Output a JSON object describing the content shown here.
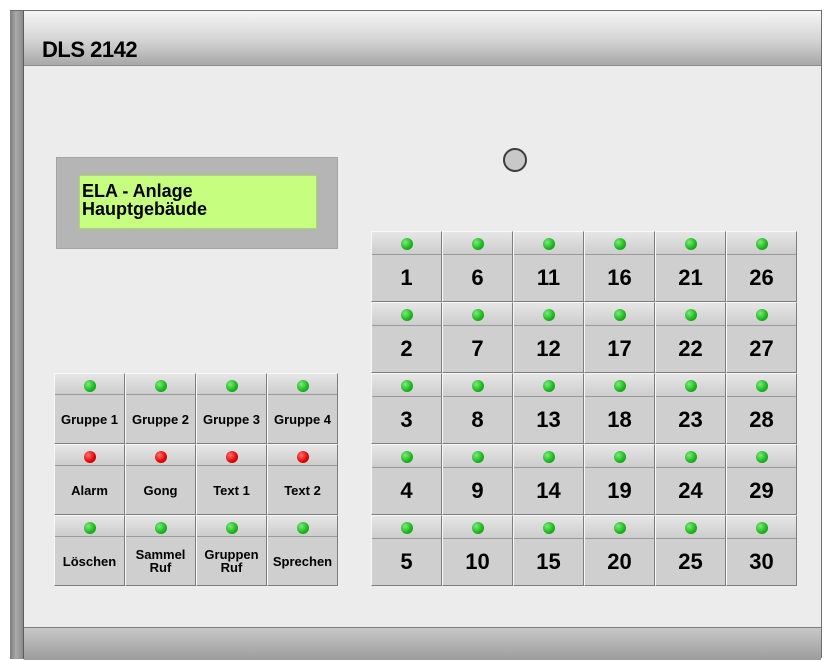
{
  "device": {
    "title": "DLS 2142"
  },
  "display": {
    "line1": "ELA - Anlage",
    "line2": "Hauptgebäude"
  },
  "colors": {
    "led_green": "#18b518",
    "led_red": "#e00000",
    "display_background": "#c6ff80"
  },
  "function_keys": {
    "rows": [
      [
        {
          "label": "Gruppe 1",
          "led": "green"
        },
        {
          "label": "Gruppe 2",
          "led": "green"
        },
        {
          "label": "Gruppe 3",
          "led": "green"
        },
        {
          "label": "Gruppe 4",
          "led": "green"
        }
      ],
      [
        {
          "label": "Alarm",
          "led": "red"
        },
        {
          "label": "Gong",
          "led": "red"
        },
        {
          "label": "Text 1",
          "led": "red"
        },
        {
          "label": "Text 2",
          "led": "red"
        }
      ],
      [
        {
          "label": "Löschen",
          "led": "green"
        },
        {
          "label": "Sammel Ruf",
          "led": "green"
        },
        {
          "label": "Gruppen Ruf",
          "led": "green"
        },
        {
          "label": "Sprechen",
          "led": "green"
        }
      ]
    ]
  },
  "zone_keys": {
    "rows": [
      [
        {
          "label": "1",
          "led": "green"
        },
        {
          "label": "6",
          "led": "green"
        },
        {
          "label": "11",
          "led": "green"
        },
        {
          "label": "16",
          "led": "green"
        },
        {
          "label": "21",
          "led": "green"
        },
        {
          "label": "26",
          "led": "green"
        }
      ],
      [
        {
          "label": "2",
          "led": "green"
        },
        {
          "label": "7",
          "led": "green"
        },
        {
          "label": "12",
          "led": "green"
        },
        {
          "label": "17",
          "led": "green"
        },
        {
          "label": "22",
          "led": "green"
        },
        {
          "label": "27",
          "led": "green"
        }
      ],
      [
        {
          "label": "3",
          "led": "green"
        },
        {
          "label": "8",
          "led": "green"
        },
        {
          "label": "13",
          "led": "green"
        },
        {
          "label": "18",
          "led": "green"
        },
        {
          "label": "23",
          "led": "green"
        },
        {
          "label": "28",
          "led": "green"
        }
      ],
      [
        {
          "label": "4",
          "led": "green"
        },
        {
          "label": "9",
          "led": "green"
        },
        {
          "label": "14",
          "led": "green"
        },
        {
          "label": "19",
          "led": "green"
        },
        {
          "label": "24",
          "led": "green"
        },
        {
          "label": "29",
          "led": "green"
        }
      ],
      [
        {
          "label": "5",
          "led": "green"
        },
        {
          "label": "10",
          "led": "green"
        },
        {
          "label": "15",
          "led": "green"
        },
        {
          "label": "20",
          "led": "green"
        },
        {
          "label": "25",
          "led": "green"
        },
        {
          "label": "30",
          "led": "green"
        }
      ]
    ]
  }
}
